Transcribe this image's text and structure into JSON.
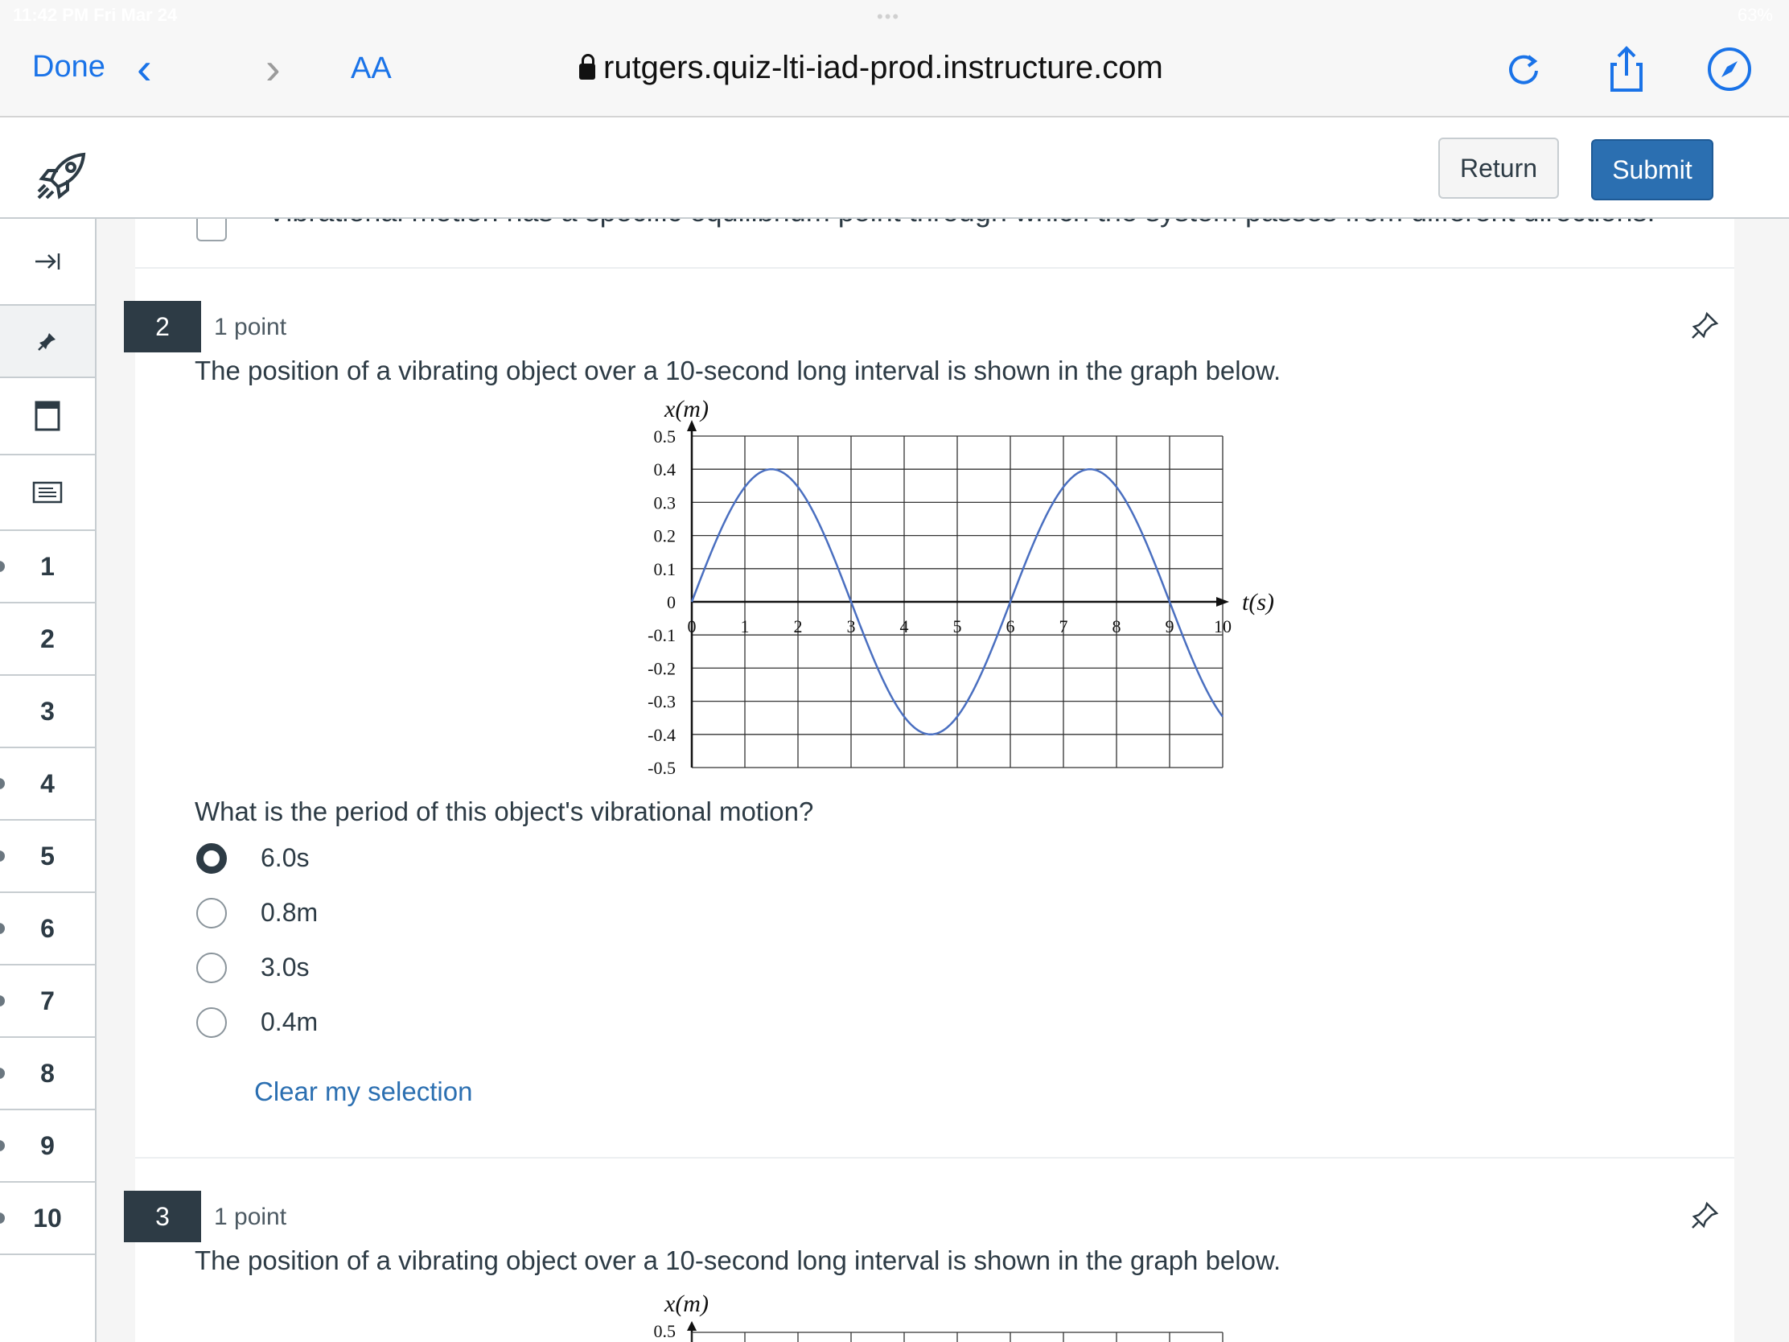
{
  "status": {
    "time": "11:42 PM  Fri Mar 24",
    "battery": "63%"
  },
  "browser": {
    "done_label": "Done",
    "text_size_label": "AA",
    "url": "rutgers.quiz-lti-iad-prod.instructure.com"
  },
  "header": {
    "return_label": "Return",
    "submit_label": "Submit"
  },
  "rail": {
    "questions": [
      "1",
      "2",
      "3",
      "4",
      "5",
      "6",
      "7",
      "8",
      "9",
      "10"
    ]
  },
  "previous_option_text": "Vibrational motion has a specific equilibrium point through which the system passes from different directions.",
  "questions": [
    {
      "number": "2",
      "points": "1 point",
      "prompt": "The position of a vibrating object over a 10-second long interval is shown in the graph below.",
      "question": "What is the period of this object's vibrational motion?",
      "options": [
        "6.0s",
        "0.8m",
        "3.0s",
        "0.4m"
      ],
      "selected_index": 0,
      "clear_label": "Clear my selection"
    },
    {
      "number": "3",
      "points": "1 point",
      "prompt": "The position of a vibrating object over a 10-second long interval is shown in the graph below."
    }
  ],
  "chart_data": {
    "type": "line",
    "xlabel": "t(s)",
    "ylabel": "x(m)",
    "xlim": [
      0,
      10
    ],
    "ylim": [
      -0.5,
      0.5
    ],
    "x_ticks": [
      "0",
      "1",
      "2",
      "3",
      "4",
      "5",
      "6",
      "7",
      "8",
      "9",
      "10"
    ],
    "y_ticks": [
      "0.5",
      "0.4",
      "0.3",
      "0.2",
      "0.1",
      "0",
      "-0.1",
      "-0.2",
      "-0.3",
      "-0.4",
      "-0.5"
    ],
    "grid": true,
    "series": [
      {
        "amplitude": 0.4,
        "period": 6,
        "phase": 0,
        "x": [
          0,
          0.5,
          1,
          1.5,
          2,
          2.5,
          3,
          3.5,
          4,
          4.5,
          5,
          5.5,
          6,
          6.5,
          7,
          7.5,
          8,
          8.5,
          9,
          9.5,
          10
        ],
        "y": [
          0,
          0.2,
          0.346,
          0.4,
          0.346,
          0.2,
          0,
          -0.2,
          -0.346,
          -0.4,
          -0.346,
          -0.2,
          0,
          0.2,
          0.346,
          0.4,
          0.346,
          0.2,
          0,
          -0.2,
          -0.346
        ]
      }
    ],
    "color": "#4a6fc0"
  },
  "colors": {
    "accent": "#2b6fb1",
    "badge": "#2d3b45",
    "link": "#2b6fb1"
  }
}
